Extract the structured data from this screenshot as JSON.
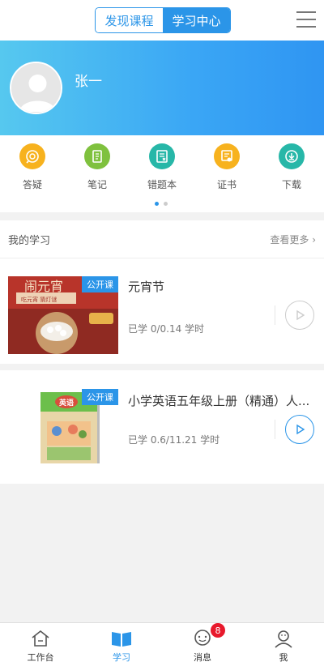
{
  "topbar": {
    "tab_discover": "发现课程",
    "tab_study": "学习中心",
    "menu_icon": "hamburger-menu-icon"
  },
  "profile": {
    "name": "张一"
  },
  "quick_actions": [
    {
      "label": "答疑",
      "icon": "qa-icon",
      "color": "#f7b21e"
    },
    {
      "label": "笔记",
      "icon": "notes-icon",
      "color": "#7fc13e"
    },
    {
      "label": "错题本",
      "icon": "mistake-book-icon",
      "color": "#27b7a8"
    },
    {
      "label": "证书",
      "icon": "certificate-icon",
      "color": "#f7b21e"
    },
    {
      "label": "下载",
      "icon": "download-icon",
      "color": "#27b7a8"
    }
  ],
  "study": {
    "title": "我的学习",
    "more": "查看更多",
    "courses": [
      {
        "badge": "公开课",
        "title": "元宵节",
        "progress": "已学 0/0.14 学时",
        "thumb_title": "闹元宵",
        "thumb_subtitle": "吃元宵 猜灯谜"
      },
      {
        "badge": "公开课",
        "title": "小学英语五年级上册（精通）人...",
        "progress": "已学 0.6/11.21 学时",
        "thumb_title": "英语"
      }
    ]
  },
  "tabbar": [
    {
      "label": "工作台",
      "icon": "home-icon",
      "active": false
    },
    {
      "label": "学习",
      "icon": "book-icon",
      "active": true
    },
    {
      "label": "消息",
      "icon": "chat-icon",
      "active": false,
      "badge": "8"
    },
    {
      "label": "我",
      "icon": "user-icon",
      "active": false
    }
  ],
  "colors": {
    "accent": "#2b95e8",
    "badge_red": "#e8192c"
  }
}
